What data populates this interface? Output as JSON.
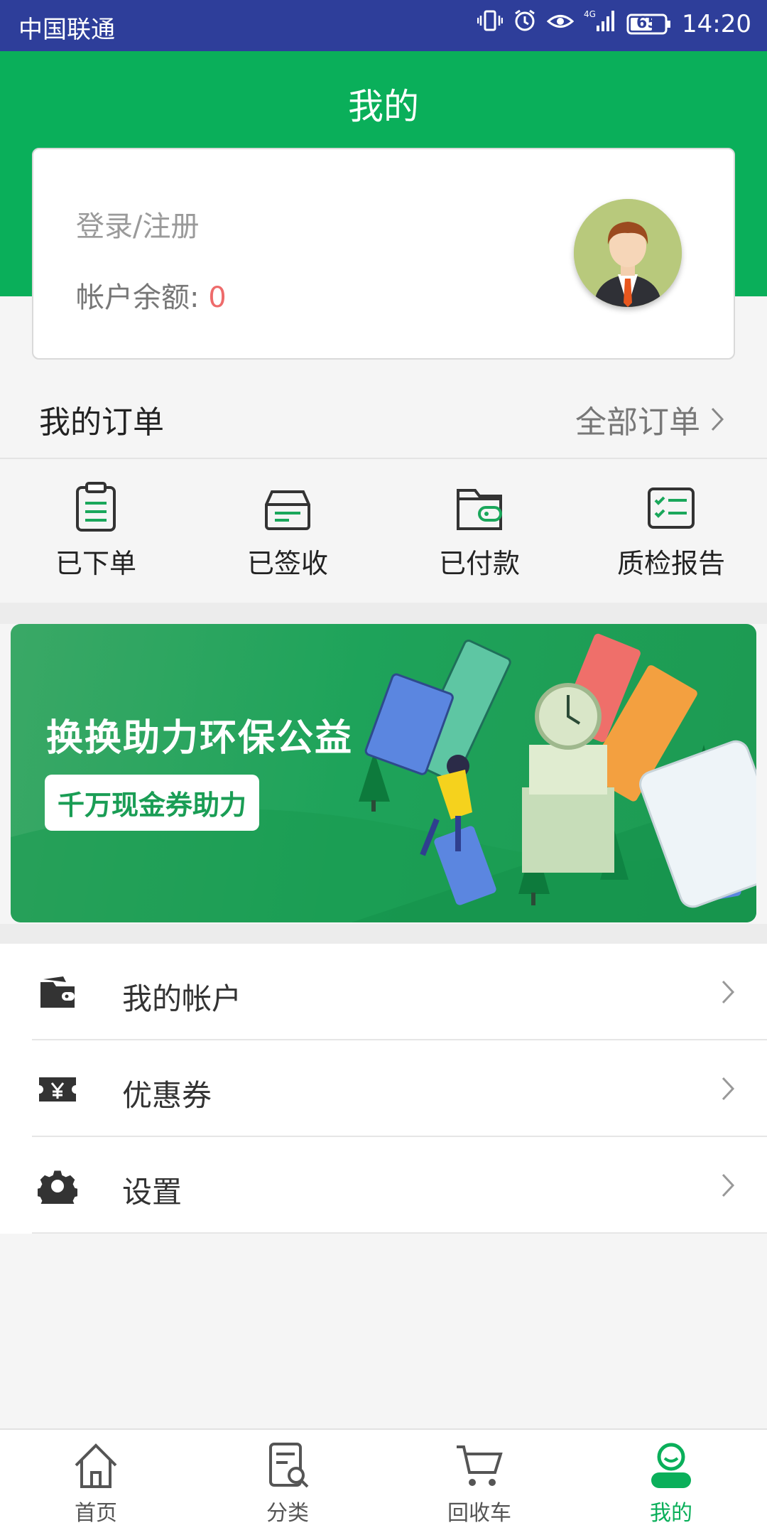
{
  "status_bar": {
    "carrier": "中国联通",
    "network": "4G",
    "battery": "65",
    "time": "14:20"
  },
  "header": {
    "title": "我的"
  },
  "profile": {
    "login_label": "登录/注册",
    "balance_label": "帐户余额: ",
    "balance_value": "0"
  },
  "orders": {
    "title": "我的订单",
    "all_label": "全部订单",
    "items": [
      {
        "label": "已下单",
        "icon": "clipboard-icon"
      },
      {
        "label": "已签收",
        "icon": "inbox-icon"
      },
      {
        "label": "已付款",
        "icon": "wallet-icon"
      },
      {
        "label": "质检报告",
        "icon": "checklist-icon"
      }
    ]
  },
  "banner": {
    "title": "换换助力环保公益",
    "button": "千万现金券助力"
  },
  "menu": {
    "items": [
      {
        "label": "我的帐户",
        "icon": "wallet-icon"
      },
      {
        "label": "优惠券",
        "icon": "coupon-icon"
      },
      {
        "label": "设置",
        "icon": "gear-icon"
      }
    ]
  },
  "tabbar": {
    "items": [
      {
        "label": "首页",
        "icon": "home-icon"
      },
      {
        "label": "分类",
        "icon": "category-icon"
      },
      {
        "label": "回收车",
        "icon": "cart-icon"
      },
      {
        "label": "我的",
        "icon": "user-icon"
      }
    ],
    "active_index": 3
  },
  "colors": {
    "primary_green": "#0aaf5a",
    "status_bar": "#2e3e9a",
    "balance_red": "#ee6b6b"
  }
}
